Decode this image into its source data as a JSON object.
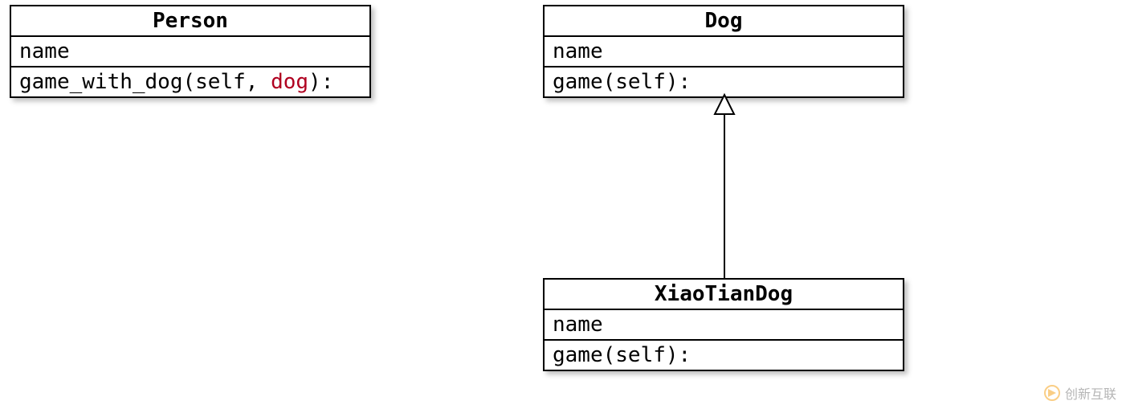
{
  "classes": {
    "person": {
      "title": "Person",
      "attr": "name",
      "method_prefix": "game_with_dog(self, ",
      "method_param": "dog",
      "method_suffix": "):"
    },
    "dog": {
      "title": "Dog",
      "attr": "name",
      "method": "game(self):"
    },
    "xiaotian": {
      "title": "XiaoTianDog",
      "attr": "name",
      "method": "game(self):"
    }
  },
  "watermark": {
    "text": "创新互联"
  }
}
